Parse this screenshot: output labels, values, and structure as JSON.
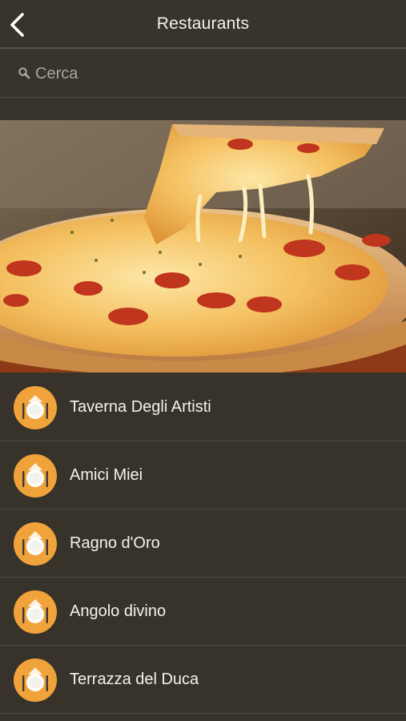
{
  "header": {
    "title": "Restaurants",
    "back_icon": "chevron-left-icon"
  },
  "search": {
    "placeholder": "Cerca",
    "value": "",
    "icon": "search-icon"
  },
  "hero": {
    "image": "pizza-photo"
  },
  "restaurants": [
    {
      "name": "Taverna Degli Artisti",
      "icon": "plate-cutlery-icon"
    },
    {
      "name": "Amici Miei",
      "icon": "plate-cutlery-icon"
    },
    {
      "name": "Ragno d'Oro",
      "icon": "plate-cutlery-icon"
    },
    {
      "name": "Angolo divino",
      "icon": "plate-cutlery-icon"
    },
    {
      "name": "Terrazza del Duca",
      "icon": "plate-cutlery-icon"
    }
  ],
  "colors": {
    "background": "#37332a",
    "accent": "#f0a33a",
    "text": "#ffffff"
  }
}
